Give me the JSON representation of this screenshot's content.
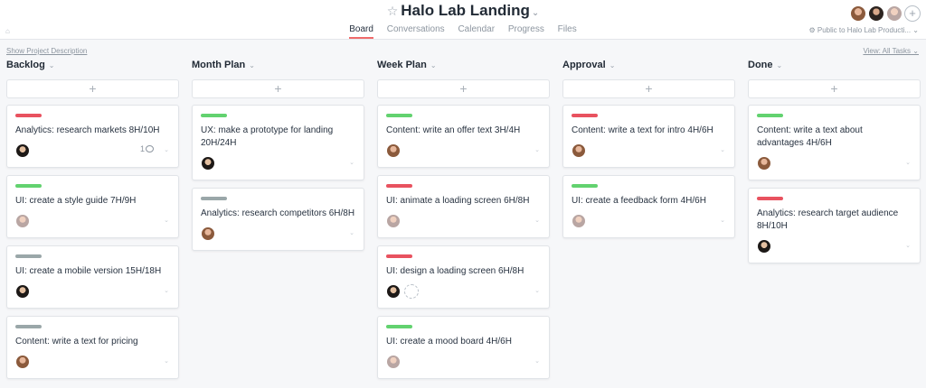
{
  "project": {
    "title": "Halo Lab Landing",
    "tabs": [
      "Board",
      "Conversations",
      "Calendar",
      "Progress",
      "Files"
    ],
    "active_tab": "Board",
    "privacy": "Public to Halo Lab Producti...",
    "show_description": "Show Project Description",
    "view_filter": "View: All Tasks"
  },
  "colors": {
    "red": "#e8525f",
    "green": "#62d26f",
    "gray": "#9aa7a9",
    "accent": "#f06a6a"
  },
  "columns": [
    {
      "title": "Backlog",
      "cards": [
        {
          "tag": "red",
          "title": "Analytics: research markets 8H/10H",
          "assignee": "av-d",
          "comments": "1"
        },
        {
          "tag": "green",
          "title": "UI: create a style guide 7H/9H",
          "assignee": "av-c"
        },
        {
          "tag": "gray",
          "title": "UI: create a mobile version 15H/18H",
          "assignee": "av-d"
        },
        {
          "tag": "gray",
          "title": "Content: write a text for pricing",
          "assignee": "av-a"
        }
      ]
    },
    {
      "title": "Month Plan",
      "cards": [
        {
          "tag": "green",
          "title": "UX: make a prototype for landing 20H/24H",
          "assignee": "av-d"
        },
        {
          "tag": "gray",
          "title": "Analytics: research competitors 6H/8H",
          "assignee": "av-a"
        }
      ]
    },
    {
      "title": "Week Plan",
      "cards": [
        {
          "tag": "green",
          "title": "Content: write an offer text 3H/4H",
          "assignee": "av-a"
        },
        {
          "tag": "red",
          "title": "UI: animate a loading screen 6H/8H",
          "assignee": "av-c"
        },
        {
          "tag": "red",
          "title": "UI: design a loading screen 6H/8H",
          "assignee": "av-d",
          "extra_assignee": true
        },
        {
          "tag": "green",
          "title": "UI: create a mood board 4H/6H",
          "assignee": "av-c"
        }
      ]
    },
    {
      "title": "Approval",
      "cards": [
        {
          "tag": "red",
          "title": "Content: write a text for intro 4H/6H",
          "assignee": "av-a"
        },
        {
          "tag": "green",
          "title": "UI: create a feedback form 4H/6H",
          "assignee": "av-c"
        }
      ]
    },
    {
      "title": "Done",
      "cards": [
        {
          "tag": "green",
          "title": "Content: write a text about advantages 4H/6H",
          "assignee": "av-a"
        },
        {
          "tag": "red",
          "title": "Analytics: research target audience 8H/10H",
          "assignee": "av-d"
        }
      ]
    }
  ]
}
